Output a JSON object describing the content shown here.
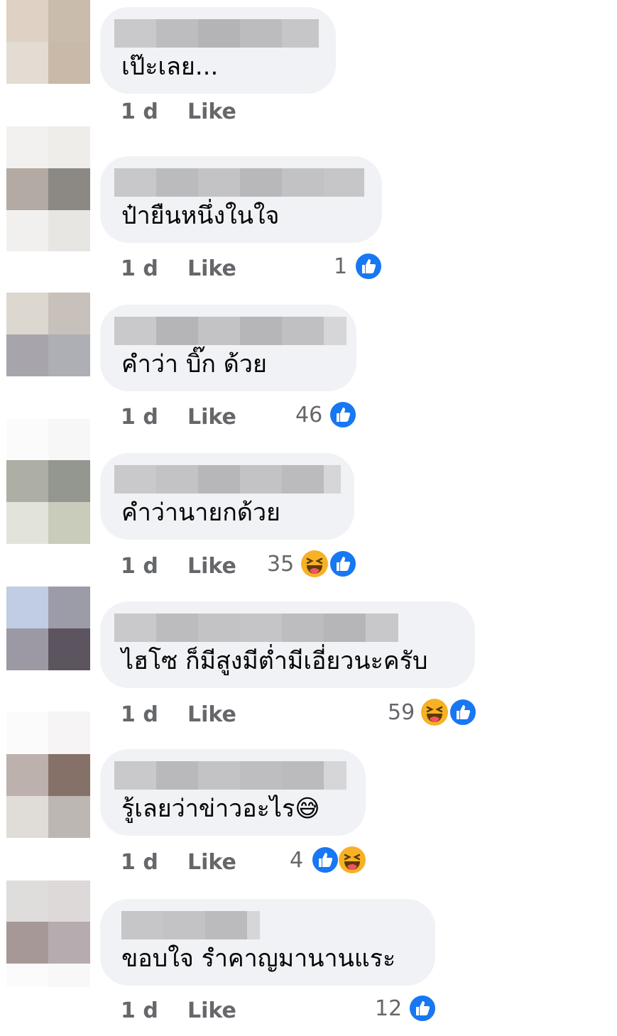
{
  "colors": {
    "bubble": "#f0f2f5",
    "meta_text": "#65676b",
    "like_blue": "#1877f2",
    "haha_yellow": "#f7b125"
  },
  "comments": [
    {
      "text": "เป๊ะเลย...",
      "time": "1 d",
      "like_label": "Like",
      "reaction_count": "",
      "reactions": []
    },
    {
      "text": "ป๋ายืนหนึ่งในใจ",
      "time": "1 d",
      "like_label": "Like",
      "reaction_count": "1",
      "reactions": [
        "like-icon"
      ]
    },
    {
      "text": "คำว่า บิ๊ก ด้วย",
      "time": "1 d",
      "like_label": "Like",
      "reaction_count": "46",
      "reactions": [
        "like-icon"
      ]
    },
    {
      "text": "คำว่านายกด้วย",
      "time": "1 d",
      "like_label": "Like",
      "reaction_count": "35",
      "reactions": [
        "haha-icon",
        "like-icon"
      ]
    },
    {
      "text": "ไฮโซ ก็มีสูงมีต่ำมีเอี่ยวนะครับ",
      "time": "1 d",
      "like_label": "Like",
      "reaction_count": "59",
      "reactions": [
        "haha-icon",
        "like-icon"
      ]
    },
    {
      "text": "รู้เลยว่าข่าวอะไร😅",
      "time": "1 d",
      "like_label": "Like",
      "reaction_count": "4",
      "reactions": [
        "like-icon",
        "haha-icon"
      ]
    },
    {
      "text": "ขอบใจ รำคาญมานานแระ",
      "time": "1 d",
      "like_label": "Like",
      "reaction_count": "12",
      "reactions": [
        "like-icon"
      ]
    }
  ]
}
